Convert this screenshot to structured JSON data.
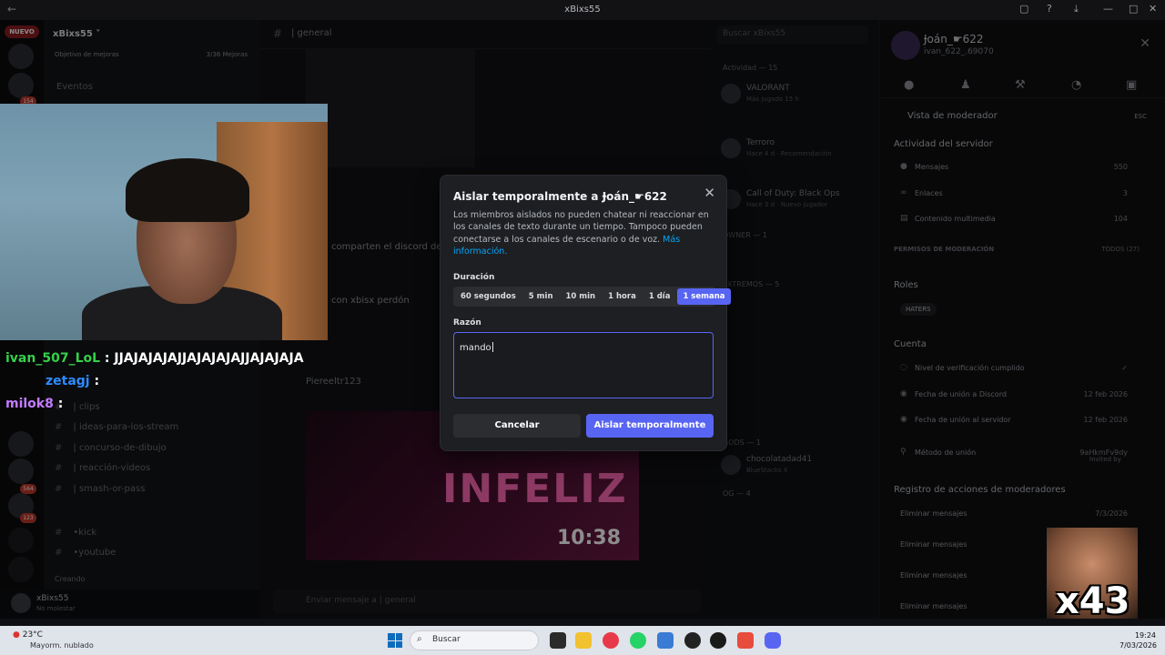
{
  "window": {
    "title": "xBixs55",
    "back": "←",
    "ctl": [
      "▢",
      "?",
      "⤓",
      "—",
      "□",
      "✕"
    ]
  },
  "rail": {
    "new_pill": "NUEVO",
    "badges": [
      "154",
      "564",
      "123"
    ]
  },
  "server": {
    "name": "xBixs55",
    "goal_label": "Objetivo de mejoras",
    "goal_value": "3/36 Mejoras",
    "events": "Eventos",
    "channels": [
      {
        "label": "| clips"
      },
      {
        "label": "| ideas-para-los-stream"
      },
      {
        "label": "| concurso-de-dibujo"
      },
      {
        "label": "| reacción-videos"
      },
      {
        "label": "| smash-or-pass"
      },
      {
        "label": "•kick"
      },
      {
        "label": "•youtube"
      }
    ],
    "category": "Creando"
  },
  "chat": {
    "channel": "| general",
    "lines": [
      "comparten el discord de",
      "con xbisx perdón",
      "10:38"
    ],
    "promo_word": "INFELIZ",
    "composer_placeholder": "Enviar mensaje a | general",
    "author": "Piereeltr123"
  },
  "overlay_chat": [
    {
      "user": "ivan_507_LoL",
      "text": " : JJAJAJAJAJJAJAJAJAJJAJAJAJA",
      "color": "#35d14a"
    },
    {
      "user": "zetagj",
      "text": " :",
      "color": "#2e8bff"
    },
    {
      "user": "milok8",
      "text": " :",
      "color": "#c47bff"
    }
  ],
  "members": {
    "search_placeholder": "Buscar xBixs55",
    "sections": [
      "Actividad — 15",
      "OWNER — 1",
      "EXTREMOS — 5",
      "GODS — 1",
      "OG — 4"
    ],
    "items": [
      {
        "name": "VALORANT",
        "sub": "Más jugado 15 h"
      },
      {
        "name": "Terroro",
        "sub": "Hace 4 d · Recomendación"
      },
      {
        "name": "Call of Duty: Black Ops",
        "sub": "Hace 3 d · Nuevo jugador"
      },
      {
        "name": "chocolatadad41",
        "sub": "BlueStacks X"
      }
    ]
  },
  "profile": {
    "display_name": "Ɉoán_☛622",
    "username": "ivan_622_.69070",
    "mod_view": "Vista de moderador",
    "esc": "ESC",
    "activity_title": "Actividad del servidor",
    "rows": [
      {
        "label": "Mensajes",
        "value": "550"
      },
      {
        "label": "Enlaces",
        "value": "3"
      },
      {
        "label": "Contenido multimedia",
        "value": "104"
      }
    ],
    "perm_title": "PERMISOS DE MODERACIÓN",
    "perm_all": "TODOS (27)",
    "roles_title": "Roles",
    "role_name": "HATERS",
    "account_title": "Cuenta",
    "account_rows": [
      {
        "label": "Nivel de verificación cumplido",
        "value": ""
      },
      {
        "label": "Fecha de unión a Discord",
        "value": "12 feb 2026"
      },
      {
        "label": "Fecha de unión al servidor",
        "value": "12 feb 2026"
      },
      {
        "label": "Método de unión",
        "value": "9aHkmFv9dy"
      }
    ],
    "invited_by": "Invited by",
    "log_title": "Registro de acciones de moderadores",
    "log_rows": [
      {
        "label": "Eliminar mensajes",
        "value": "7/3/2026"
      },
      {
        "label": "Eliminar mensajes",
        "value": ""
      },
      {
        "label": "Eliminar mensajes",
        "value": ""
      },
      {
        "label": "Eliminar mensajes",
        "value": ""
      }
    ]
  },
  "user_panel": {
    "name": "xBixs55",
    "status": "No molestar"
  },
  "modal": {
    "title": "Aislar temporalmente a Ɉoán_☛622",
    "description": "Los miembros aislados no pueden chatear ni reaccionar en los canales de texto durante un tiempo. Tampoco pueden conectarse a los canales de escenario o de voz.",
    "more_info": "Más información.",
    "duration_label": "Duración",
    "durations": [
      "60 segundos",
      "5 min",
      "10 min",
      "1 hora",
      "1 día",
      "1 semana"
    ],
    "selected_duration": "1 semana",
    "reason_label": "Razón",
    "reason_value": "mando",
    "cancel_label": "Cancelar",
    "confirm_label": "Aislar temporalmente",
    "close_glyph": "✕"
  },
  "emote": {
    "text": "x43"
  },
  "taskbar": {
    "temp": "23°C",
    "weather": "Mayorm. nublado",
    "search_placeholder": "Buscar",
    "time": "19:24",
    "date": "7/03/2026"
  }
}
